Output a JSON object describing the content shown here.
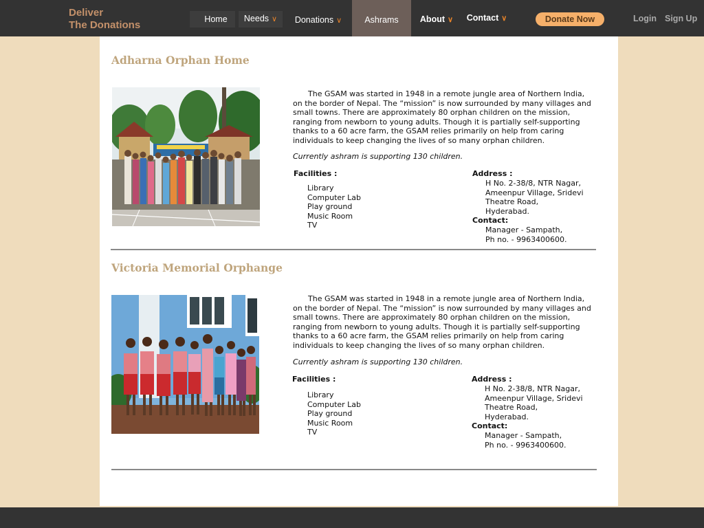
{
  "brand": {
    "line1": "Deliver",
    "line2": "The Donations"
  },
  "nav": {
    "home": "Home",
    "needs": "Needs",
    "donations": "Donations",
    "ashrams": "Ashrams",
    "about": "About",
    "contact": "Contact",
    "donate_now": "Donate Now",
    "login": "Login",
    "signup": "Sign Up"
  },
  "colors": {
    "accent": "#e8832a",
    "brand": "#c4916a",
    "title": "#bfa57d",
    "bar": "#333333",
    "page_bg": "#efdcbc"
  },
  "ashrams": [
    {
      "name": "Adharna Orphan Home",
      "description": "The GSAM was started in 1948 in a remote jungle area of Northern India, on the border of Nepal. The “mission” is now surrounded by many villages and small towns. There are approximately 80 orphan children on the mission, ranging from newborn to young adults. Though it is partially self-supporting thanks to a 60 acre farm, the GSAM relies primarily on help from caring individuals to keep changing the lives of so many orphan children.",
      "support": "Currently ashram is supporting 130 children.",
      "facilities_label": "Facilities :",
      "facilities": [
        "Library",
        "Computer Lab",
        "Play ground",
        "Music Room",
        "TV"
      ],
      "address_label": "Address :",
      "address": [
        "H No. 2-38/8, NTR Nagar,",
        "Ameenpur Village, Sridevi",
        "Theatre Road,",
        "Hyderabad."
      ],
      "contact_label": "Contact:",
      "contact": [
        "Manager - Sampath,",
        "Ph no. - 9963400600."
      ]
    },
    {
      "name": "Victoria Memorial Orphange",
      "description": "The GSAM was started in 1948 in a remote jungle area of Northern India, on the border of Nepal. The “mission” is now surrounded by many villages and small towns. There are approximately 80 orphan children on the mission, ranging from newborn to young adults. Though it is partially self-supporting thanks to a 60 acre farm, the GSAM relies primarily on help from caring individuals to keep changing the lives of so many orphan children.",
      "support": "Currently ashram is supporting 130 children.",
      "facilities_label": "Facilities :",
      "facilities": [
        "Library",
        "Computer Lab",
        "Play ground",
        "Music Room",
        "TV"
      ],
      "address_label": "Address :",
      "address": [
        "H No. 2-38/8, NTR Nagar,",
        "Ameenpur Village, Sridevi",
        "Theatre Road,",
        "Hyderabad."
      ],
      "contact_label": "Contact:",
      "contact": [
        "Manager - Sampath,",
        "Ph no. - 9963400600."
      ]
    }
  ]
}
